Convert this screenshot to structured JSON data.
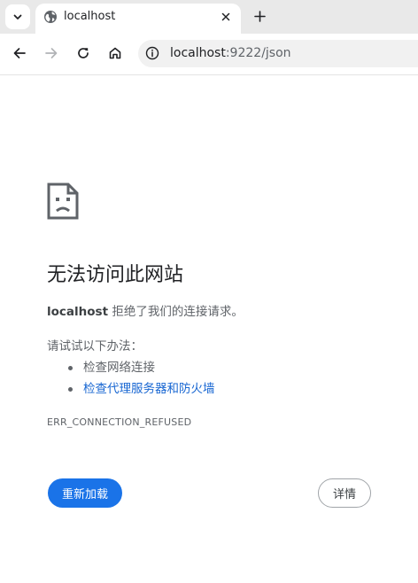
{
  "tabs": [
    {
      "title": "localhost",
      "favicon": "globe-icon",
      "active": true
    }
  ],
  "tabstrip": {
    "search_icon": "chevron-down-icon",
    "close_icon": "close-icon",
    "new_tab_icon": "plus-icon"
  },
  "toolbar": {
    "back_icon": "arrow-left-icon",
    "forward_icon": "arrow-right-icon",
    "reload_icon": "reload-icon",
    "home_icon": "home-icon",
    "site_info_icon": "info-icon"
  },
  "omnibox": {
    "host": "localhost",
    "rest": ":9222/json"
  },
  "error": {
    "icon": "sad-page-icon",
    "title": "无法访问此网站",
    "host": "localhost",
    "description": " 拒绝了我们的连接请求。",
    "suggestions_heading": "请试试以下办法：",
    "suggestions": [
      {
        "text": "检查网络连接",
        "link": false
      },
      {
        "text": "检查代理服务器和防火墙",
        "link": true
      }
    ],
    "code": "ERR_CONNECTION_REFUSED",
    "reload_label": "重新加载",
    "details_label": "详情"
  },
  "colors": {
    "accent": "#1a73e8",
    "link": "#1967d2",
    "text_primary": "#202124",
    "text_secondary": "#5f6368",
    "tabstrip_bg": "#e9e9e9"
  }
}
